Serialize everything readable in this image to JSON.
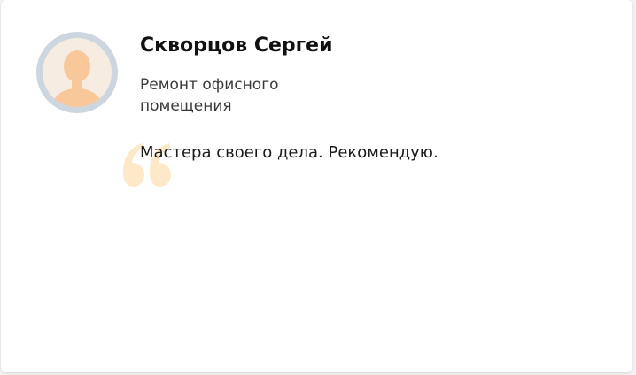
{
  "review_card": {
    "author_name": "Скворцов Сергей",
    "service": "Ремонт офисного помещения",
    "review_text": "Мастера своего дела. Рекомендую."
  },
  "icons": {
    "avatar": "person-placeholder-icon",
    "quote": "open-quote-icon"
  },
  "colors": {
    "avatar_ring": "#cdd6df",
    "avatar_bg": "#f7ece2",
    "avatar_figure": "#f8c79a",
    "quote_mark": "#fde9c8"
  }
}
